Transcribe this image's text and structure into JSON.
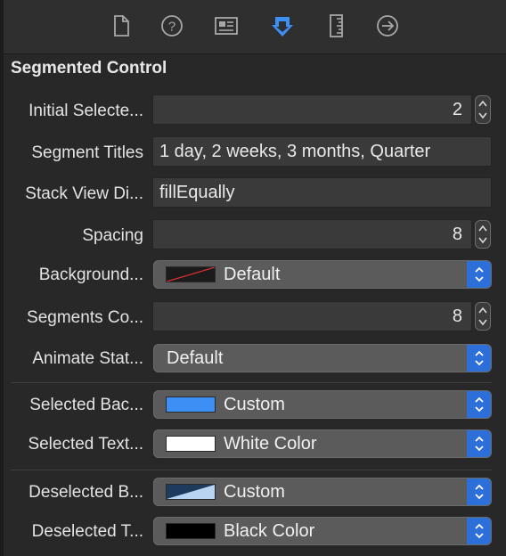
{
  "toolbar": {
    "tabs": [
      {
        "icon": "file-inspector-icon"
      },
      {
        "icon": "quick-help-icon"
      },
      {
        "icon": "identity-inspector-icon"
      },
      {
        "icon": "attributes-inspector-icon",
        "selected": true
      },
      {
        "icon": "size-inspector-icon"
      },
      {
        "icon": "connections-inspector-icon"
      }
    ],
    "selected_color": "#3d8ef5",
    "icon_color": "#a8a8a8"
  },
  "section": {
    "title": "Segmented Control"
  },
  "rows": {
    "initial_selected": {
      "label": "Initial Selecte...",
      "value": "2"
    },
    "segment_titles": {
      "label": "Segment Titles",
      "value": "1 day, 2 weeks, 3 months, Quarter"
    },
    "stack_view_distribution": {
      "label": "Stack View Di...",
      "value": "fillEqually"
    },
    "spacing": {
      "label": "Spacing",
      "value": "8"
    },
    "background": {
      "label": "Background...",
      "value": "Default"
    },
    "segments_corner": {
      "label": "Segments Co...",
      "value": "8"
    },
    "animate_state": {
      "label": "Animate Stat...",
      "value": "Default"
    },
    "selected_background": {
      "label": "Selected Bac...",
      "value": "Custom",
      "swatch": "#3d8ef5"
    },
    "selected_text": {
      "label": "Selected Text...",
      "value": "White Color",
      "swatch": "#ffffff"
    },
    "deselected_background": {
      "label": "Deselected B...",
      "value": "Custom",
      "swatch": "#1e3a5c"
    },
    "deselected_text": {
      "label": "Deselected T...",
      "value": "Black Color",
      "swatch": "#000000"
    }
  },
  "colors": {
    "accent": "#2d6fd8"
  }
}
